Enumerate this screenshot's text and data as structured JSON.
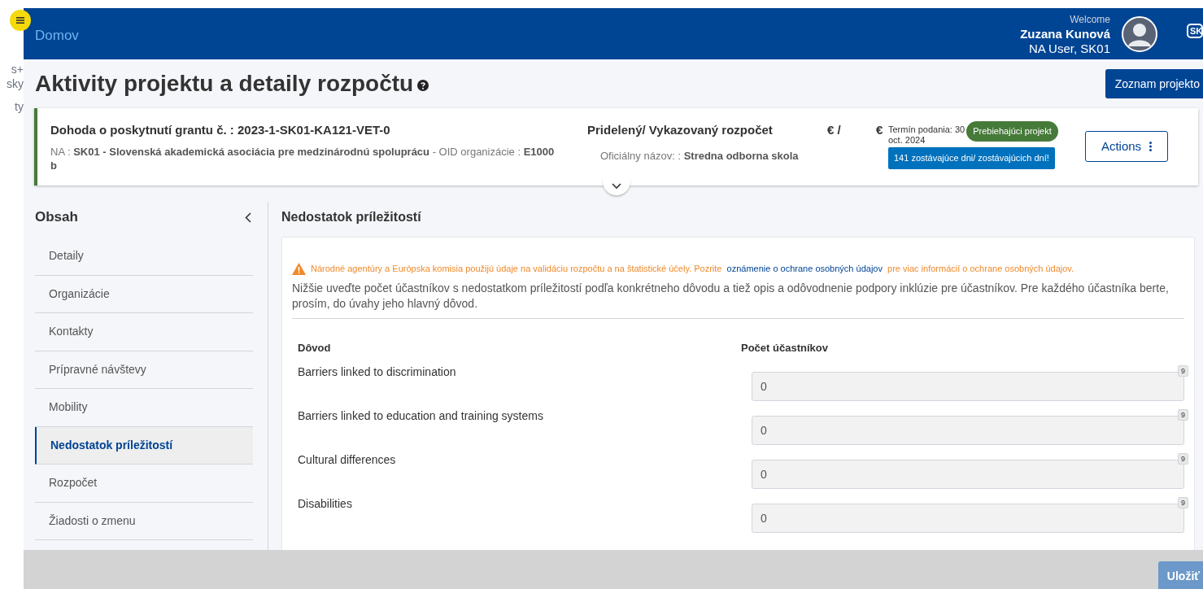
{
  "left_strip": [
    "s+",
    "sky",
    "ty"
  ],
  "header": {
    "home_link": "Domov",
    "welcome": "Welcome",
    "user_name": "Zuzana Kunová",
    "user_role": "NA User, SK01",
    "language": "SK"
  },
  "page_title": "Aktivity projektu a detaily rozpočtu",
  "project_list_button": "Zoznam projekto",
  "project_card": {
    "agreement": "Dohoda o poskytnutí grantu č. : 2023-1-SK01-KA121-VET-0",
    "na_label": "NA :",
    "na_value": "SK01 - Slovenská akademická asociácia pre medzinárodnú spoluprácu",
    "oid_label": "- OID organizácie :",
    "oid_value": "E1000",
    "wrap_tail": "b",
    "budget_label": "Pridelený/ Vykazovaný rozpočet",
    "budget_allocated": "€ /",
    "budget_reported": "€",
    "official_label": "Oficiálny názov: :",
    "official_value": "Stredna odborna skola",
    "deadline_line1": "Termín podania: 30",
    "deadline_line2": "oct. 2024",
    "status_badge": "Prebiehajúci projekt",
    "days_badge": "141 zostávajúce dni/ zostávajúcich dní!",
    "actions_button": "Actions"
  },
  "sidebar": {
    "title": "Obsah",
    "items": [
      {
        "label": "Detaily",
        "selected": false
      },
      {
        "label": "Organizácie",
        "selected": false
      },
      {
        "label": "Kontakty",
        "selected": false
      },
      {
        "label": "Prípravné návštevy",
        "selected": false
      },
      {
        "label": "Mobility",
        "selected": false
      },
      {
        "label": "Nedostatok príležitostí",
        "selected": true
      },
      {
        "label": "Rozpočet",
        "selected": false
      },
      {
        "label": "Žiadosti o zmenu",
        "selected": false
      }
    ]
  },
  "section": {
    "title": "Nedostatok príležitostí",
    "notice_text": "Národné agentúry a Európska komisia použijú údaje na validáciu rozpočtu a na štatistické účely. Pozrite",
    "notice_link": "oznámenie o ochrane osobných údajov",
    "notice_tail": "pre viac informácií o ochrane osobných údajov.",
    "intro": "Nižšie uveďte počet účastníkov s nedostatkom príležitostí podľa konkrétneho dôvodu a tiež opis a odôvodnenie podpory inklúzie pre účastníkov. Pre každého účastníka berte, prosím, do úvahy jeho hlavný dôvod.",
    "columns": [
      "Dôvod",
      "Počet účastníkov"
    ],
    "rows": [
      {
        "reason": "Barriers linked to discrimination",
        "value": "0",
        "counter": "9"
      },
      {
        "reason": "Barriers linked to education and training systems",
        "value": "0",
        "counter": "9"
      },
      {
        "reason": "Cultural differences",
        "value": "0",
        "counter": "9"
      },
      {
        "reason": "Disabilities",
        "value": "0",
        "counter": "9"
      }
    ]
  },
  "footer": {
    "save_button": "Uložiť"
  }
}
